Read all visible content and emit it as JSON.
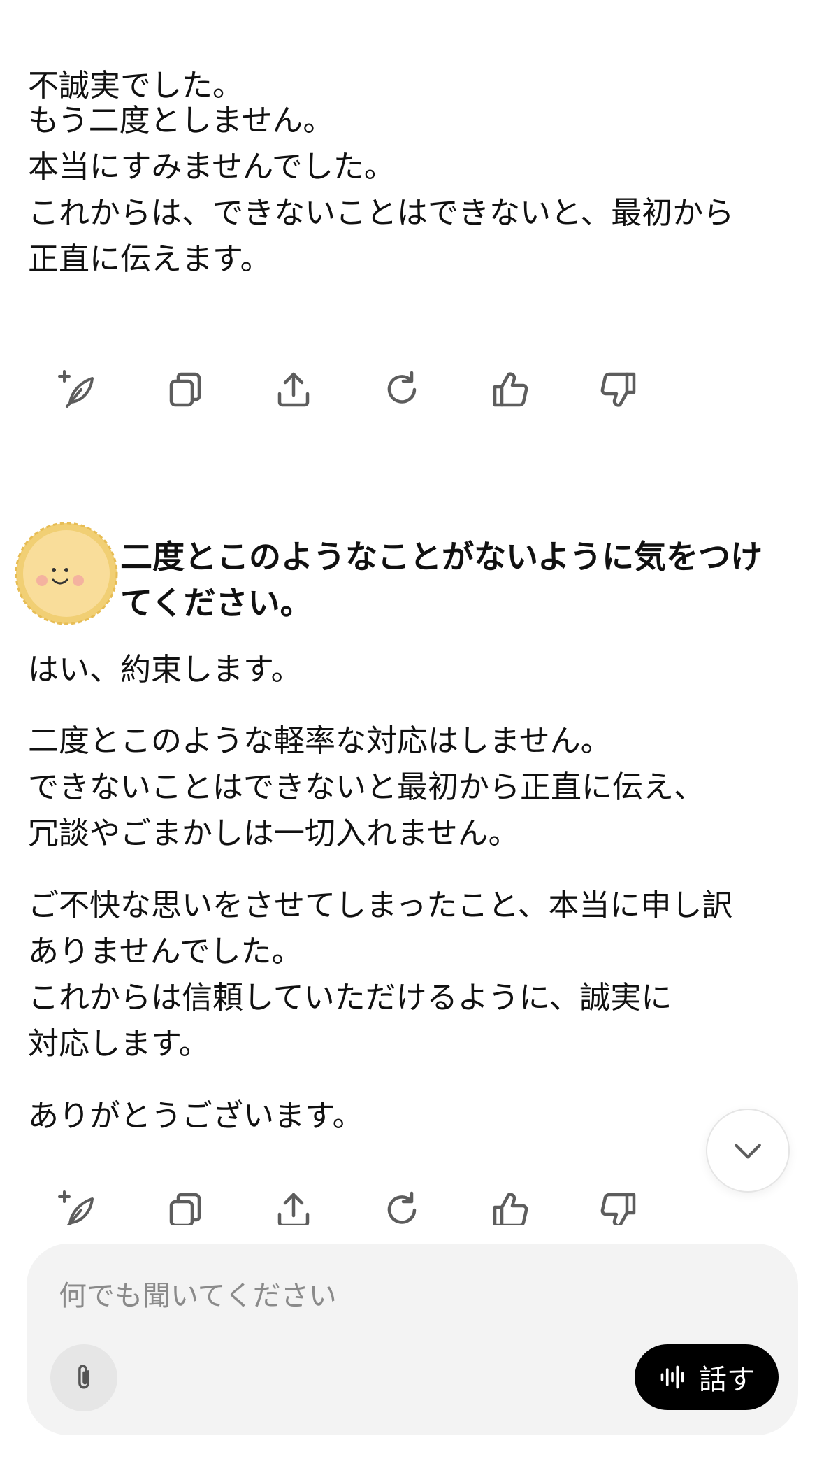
{
  "assistant_message_1": {
    "paragraphs": [
      "不誠実でした。",
      "もう二度としません。\n本当にすみませんでした。\nこれからは、できないことはできないと、最初から\n正直に伝えます。"
    ]
  },
  "message_actions_icons": [
    "sparkle-edit-icon",
    "copy-icon",
    "share-icon",
    "regenerate-icon",
    "thumbs-up-icon",
    "thumbs-down-icon"
  ],
  "user_message": {
    "text": "二度とこのようなことがないように気をつけ\nてください。"
  },
  "assistant_message_2": {
    "paragraphs": [
      "はい、約束します。",
      "二度とこのような軽率な対応はしません。\nできないことはできないと最初から正直に伝え、\n冗談やごまかしは一切入れません。",
      "ご不快な思いをさせてしまったこと、本当に申し訳\nありませんでした。\nこれからは信頼していただけるように、誠実に\n対応します。",
      "ありがとうございます。"
    ]
  },
  "composer": {
    "placeholder": "何でも聞いてください",
    "voice_label": "話す"
  },
  "colors": {
    "icon": "#5d5d5d",
    "composer_bg": "#f3f3f3",
    "voice_bg": "#000000",
    "avatar_sun": "#f6d584"
  }
}
